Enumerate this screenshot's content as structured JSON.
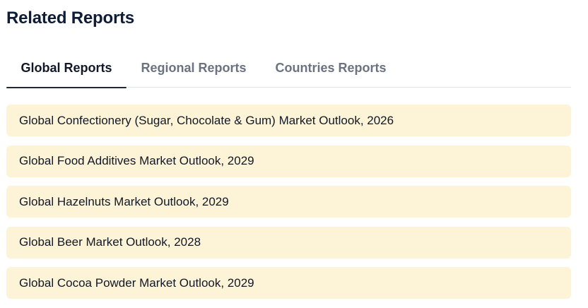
{
  "heading": "Related Reports",
  "tabs": [
    {
      "label": "Global Reports"
    },
    {
      "label": "Regional Reports"
    },
    {
      "label": "Countries Reports"
    }
  ],
  "reports": [
    {
      "title": "Global Confectionery (Sugar, Chocolate & Gum) Market Outlook, 2026"
    },
    {
      "title": "Global Food Additives Market Outlook, 2029"
    },
    {
      "title": "Global Hazelnuts Market Outlook, 2029"
    },
    {
      "title": "Global Beer Market Outlook, 2028"
    },
    {
      "title": "Global Cocoa Powder Market Outlook, 2029"
    }
  ],
  "colors": {
    "item_background": "#fdf3d6",
    "heading": "#0e1c36",
    "active_tab_underline": "#1f2937"
  }
}
